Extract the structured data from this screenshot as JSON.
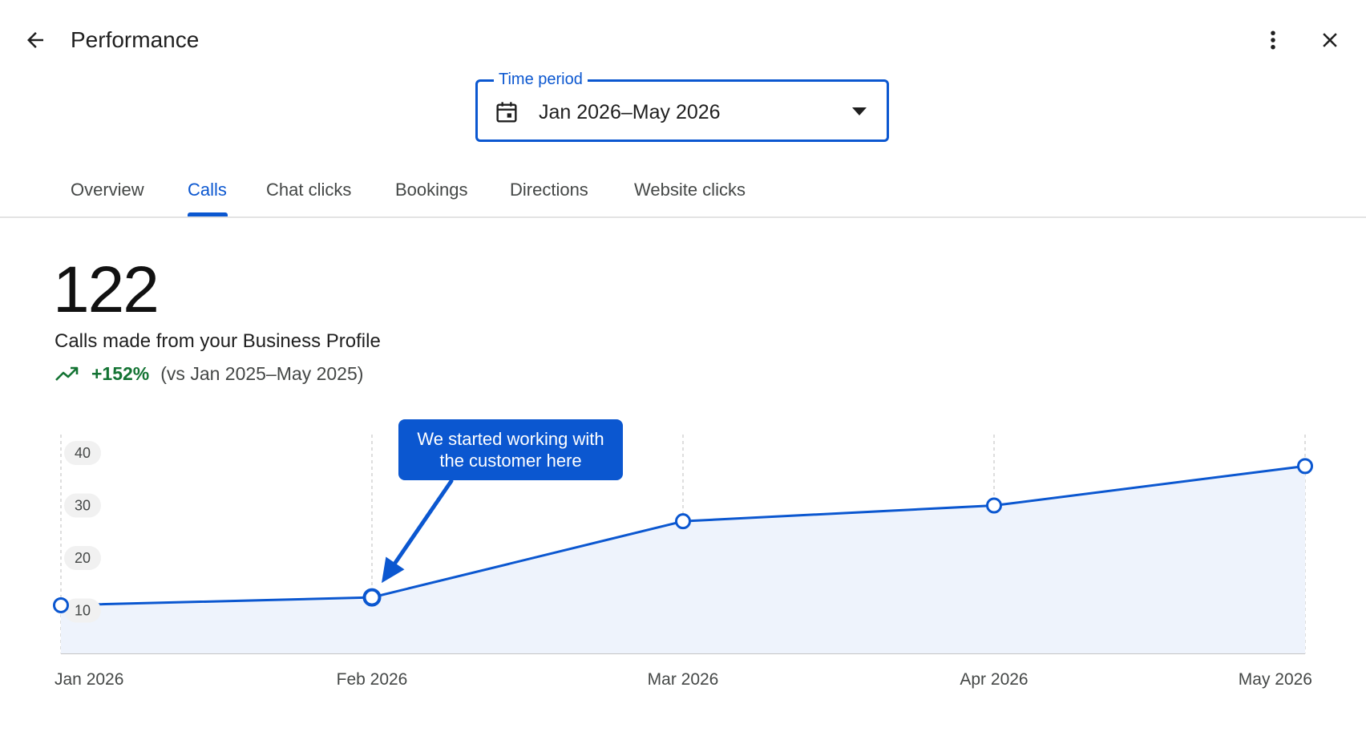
{
  "header": {
    "title": "Performance"
  },
  "time_period": {
    "label": "Time period",
    "value": "Jan 2026–May 2026"
  },
  "tabs": [
    {
      "label": "Overview",
      "active": false
    },
    {
      "label": "Calls",
      "active": true
    },
    {
      "label": "Chat clicks",
      "active": false
    },
    {
      "label": "Bookings",
      "active": false
    },
    {
      "label": "Directions",
      "active": false
    },
    {
      "label": "Website clicks",
      "active": false
    }
  ],
  "metric": {
    "value": "122",
    "description": "Calls made from your Business Profile",
    "change_pct": "+152%",
    "change_comparison": "(vs Jan 2025–May 2025)"
  },
  "annotation": {
    "text": "We started working with the customer here"
  },
  "colors": {
    "accent": "#0b57d0",
    "positive": "#137333",
    "area_fill": "#eef3fc"
  },
  "icons": {
    "back": "arrow-back-icon",
    "more": "more-vert-icon",
    "close": "close-icon",
    "calendar": "calendar-icon",
    "caret": "dropdown-caret-icon",
    "trend": "trending-up-icon"
  },
  "chart_data": {
    "type": "area",
    "x": [
      "Jan 2026",
      "Feb 2026",
      "Mar 2026",
      "Apr 2026",
      "May 2026"
    ],
    "series": [
      {
        "values": [
          11,
          12.5,
          27,
          30,
          37.5
        ]
      }
    ],
    "yticks": [
      10,
      20,
      30,
      40
    ],
    "ylim": [
      0,
      42
    ],
    "grid": "vertical-dashed",
    "annotated_point": 1
  }
}
